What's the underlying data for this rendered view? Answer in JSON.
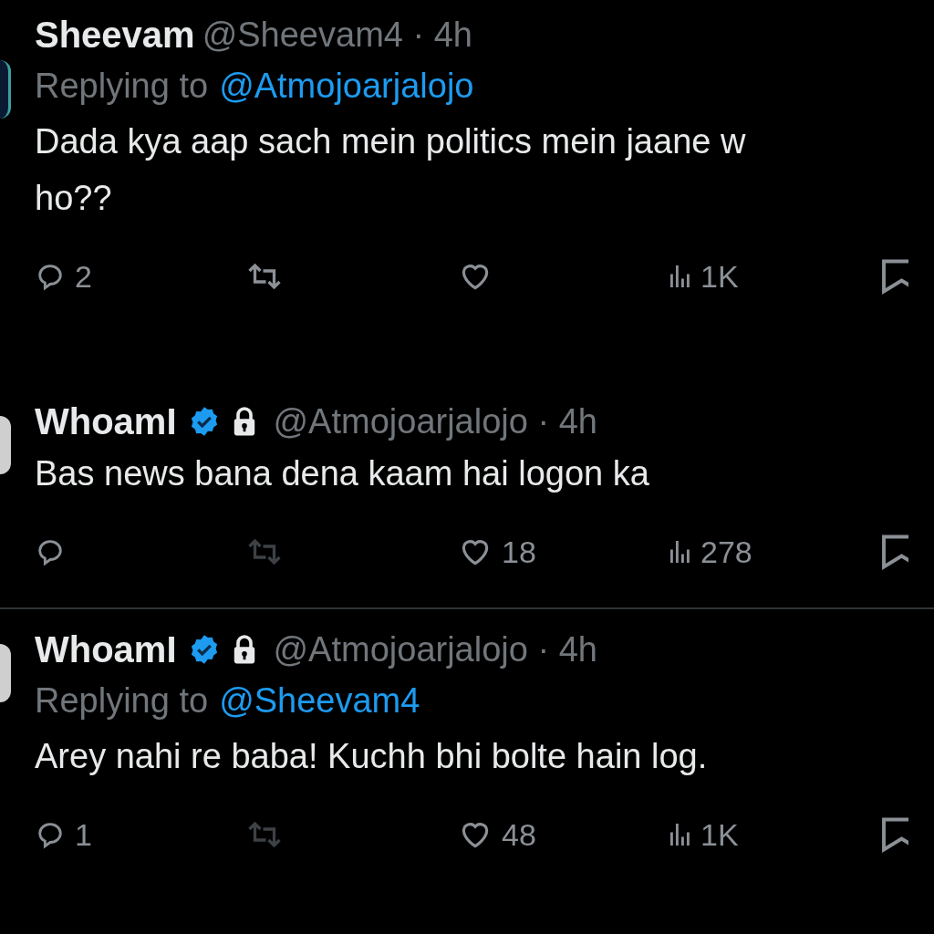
{
  "tweets": [
    {
      "name": "Sheevam",
      "verified": false,
      "protected": false,
      "meta": "@Sheevam4 · 4h",
      "replying_label": "Replying to",
      "replying_to": "@Atmojoarjalojo",
      "body": [
        "Dada kya aap sach mein politics mein jaane w",
        "ho??"
      ],
      "divider_after": false,
      "actions": [
        {
          "kind": "reply",
          "count": "2",
          "disabled": false
        },
        {
          "kind": "retweet",
          "disabled": false
        },
        {
          "kind": "like",
          "disabled": false
        },
        {
          "kind": "views",
          "count": "1K",
          "disabled": false
        },
        {
          "kind": "bookmark",
          "disabled": false
        }
      ]
    },
    {
      "name": "WhoamI",
      "verified": true,
      "protected": true,
      "meta": "@Atmojoarjalojo · 4h",
      "body": [
        "Bas news bana dena kaam hai logon ka"
      ],
      "divider_after": true,
      "actions": [
        {
          "kind": "reply",
          "disabled": false
        },
        {
          "kind": "retweet",
          "disabled": true
        },
        {
          "kind": "like",
          "count": "18",
          "disabled": false
        },
        {
          "kind": "views",
          "count": "278",
          "disabled": false
        },
        {
          "kind": "bookmark",
          "disabled": false
        }
      ]
    },
    {
      "name": "WhoamI",
      "verified": true,
      "protected": true,
      "meta": "@Atmojoarjalojo · 4h",
      "replying_label": "Replying to",
      "replying_to": "@Sheevam4",
      "body": [
        "Arey nahi re baba! Kuchh bhi bolte hain log."
      ],
      "divider_after": false,
      "actions": [
        {
          "kind": "reply",
          "count": "1",
          "disabled": false
        },
        {
          "kind": "retweet",
          "disabled": true
        },
        {
          "kind": "like",
          "count": "48",
          "disabled": false
        },
        {
          "kind": "views",
          "count": "1K",
          "disabled": false
        },
        {
          "kind": "bookmark",
          "disabled": false
        }
      ]
    }
  ]
}
